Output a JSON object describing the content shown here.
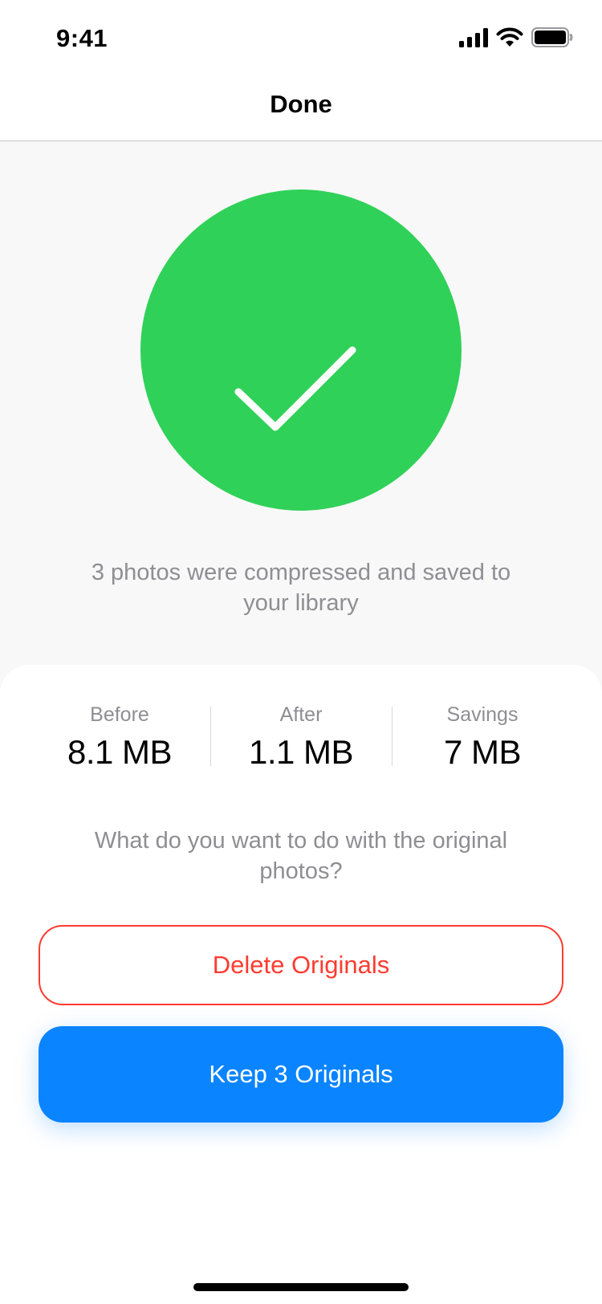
{
  "status_bar": {
    "time": "9:41",
    "icons": [
      "cellular-signal-icon",
      "wifi-icon",
      "battery-icon"
    ]
  },
  "nav": {
    "title": "Done"
  },
  "hero": {
    "icon": "checkmark-icon",
    "message": "3 photos were compressed and saved to your library",
    "accent_color": "#30D158"
  },
  "stats": [
    {
      "label": "Before",
      "value": "8.1 MB"
    },
    {
      "label": "After",
      "value": "1.1 MB"
    },
    {
      "label": "Savings",
      "value": "7 MB"
    }
  ],
  "question": "What do you want to do with the original photos?",
  "actions": {
    "delete_label": "Delete Originals",
    "delete_color": "#FF3B30",
    "keep_label": "Keep 3 Originals",
    "keep_color": "#0A84FF"
  }
}
